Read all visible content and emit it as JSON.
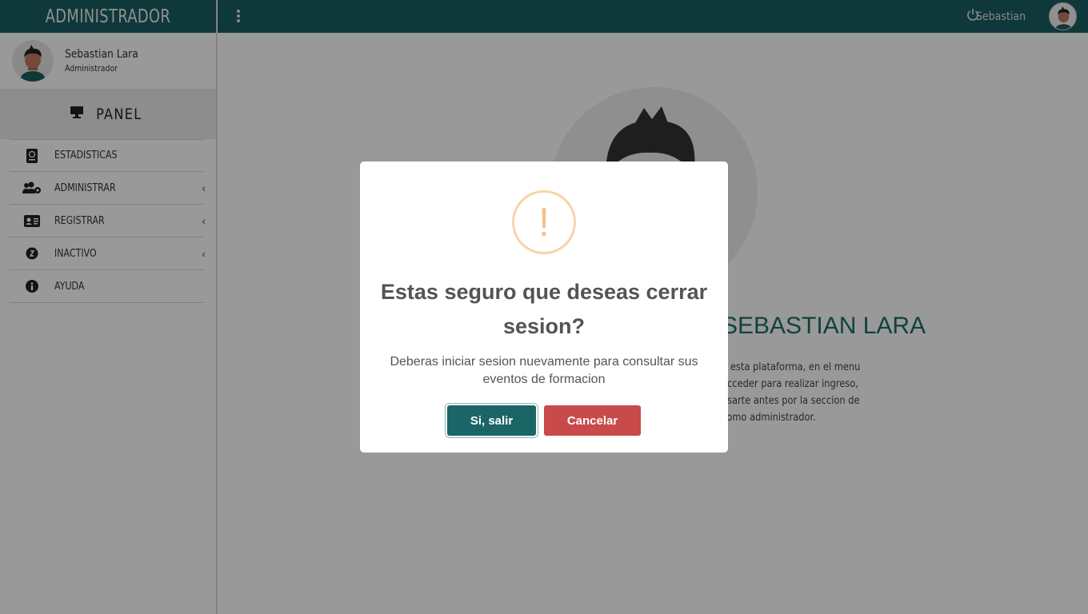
{
  "sidebar": {
    "brand": "ADMINISTRADOR",
    "user": {
      "name": "Sebastian Lara",
      "role": "Administrador"
    },
    "panel_label": "PANEL",
    "items": [
      {
        "label": "ESTADISTICAS",
        "icon": "book-icon",
        "has_submenu": false
      },
      {
        "label": "ADMINISTRAR",
        "icon": "users-cog-icon",
        "has_submenu": true
      },
      {
        "label": "REGISTRAR",
        "icon": "id-card-icon",
        "has_submenu": true
      },
      {
        "label": "INACTIVO",
        "icon": "user-clock-icon",
        "has_submenu": true
      },
      {
        "label": "AYUDA",
        "icon": "info-icon",
        "has_submenu": false
      }
    ]
  },
  "topbar": {
    "username": "Sebastian"
  },
  "main": {
    "welcome_title": "SEBASTIAN LARA",
    "paragraph_lines": [
      "n esta plataforma, en el menu",
      "acceder para realizar ingreso,",
      "asarte antes por la seccion de",
      "como administrador."
    ]
  },
  "modal": {
    "icon": "warning-icon",
    "title": "Estas seguro que deseas cerrar sesion?",
    "text": "Deberas iniciar sesion nuevamente para consultar sus eventos de formacion",
    "confirm_label": "Si, salir",
    "cancel_label": "Cancelar"
  },
  "colors": {
    "primary": "#1a5e63",
    "danger": "#c94a4a",
    "warning": "#f8d3a8"
  }
}
